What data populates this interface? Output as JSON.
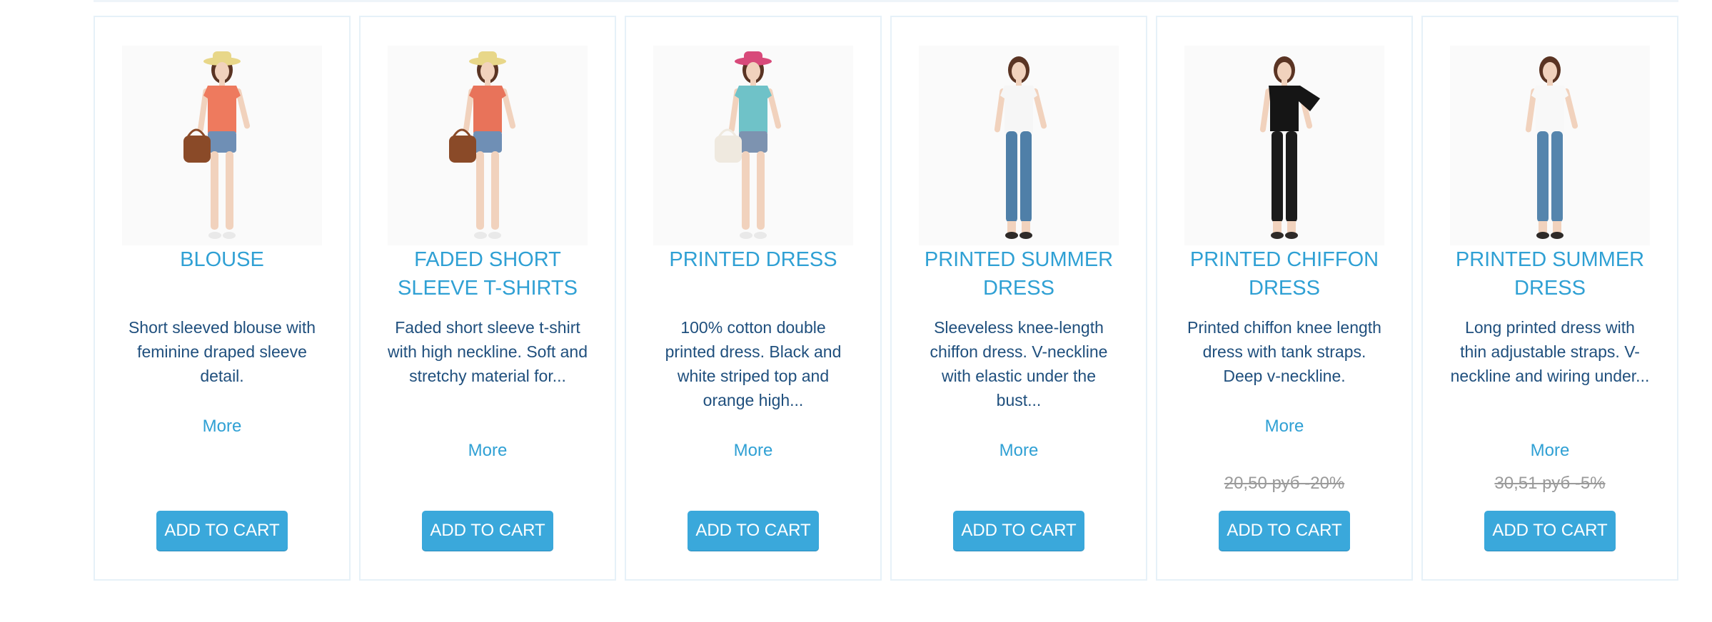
{
  "catalog": {
    "products": [
      {
        "name": "BLOUSE",
        "description": "Short sleeved blouse with feminine draped sleeve detail.",
        "more_label": "More",
        "old_price": "",
        "add_to_cart_label": "ADD TO CART",
        "image": "model-orange-blouse-bag",
        "colors": {
          "top": "#ee7a5e",
          "bottom": "#6f8fb5",
          "hat": "#e8d789",
          "bag": "#8a4a28"
        }
      },
      {
        "name": "FADED SHORT SLEEVE T-SHIRTS",
        "description": "Faded short sleeve t-shirt with high neckline. Soft and stretchy material for...",
        "more_label": "More",
        "old_price": "",
        "add_to_cart_label": "ADD TO CART",
        "image": "model-orange-tshirt-bag",
        "colors": {
          "top": "#e8735a",
          "bottom": "#6f8fb5",
          "hat": "#e8d789",
          "bag": "#8a4a28"
        }
      },
      {
        "name": "PRINTED DRESS",
        "description": "100% cotton double printed dress. Black and white striped top and orange high...",
        "more_label": "More",
        "old_price": "",
        "add_to_cart_label": "ADD TO CART",
        "image": "model-teal-top-white-bag",
        "colors": {
          "top": "#6fc2c8",
          "bottom": "#7d93b0",
          "hat": "#d84a7a",
          "bag": "#efe9df"
        }
      },
      {
        "name": "PRINTED SUMMER DRESS",
        "description": "Sleeveless knee-length chiffon dress. V-neckline with elastic under the bust...",
        "more_label": "More",
        "old_price": "",
        "add_to_cart_label": "ADD TO CART",
        "image": "model-white-top-jeans",
        "colors": {
          "top": "#f6f6f6",
          "bottom": "#4f7fa8",
          "hat": "",
          "bag": ""
        }
      },
      {
        "name": "PRINTED CHIFFON DRESS",
        "description": "Printed chiffon knee length dress with tank straps. Deep v-neckline.",
        "more_label": "More",
        "old_price": "20,50 руб -20%",
        "add_to_cart_label": "ADD TO CART",
        "image": "model-black-ruffle-outfit",
        "colors": {
          "top": "#151515",
          "bottom": "#1b1b1b",
          "hat": "",
          "bag": ""
        }
      },
      {
        "name": "PRINTED SUMMER DRESS",
        "description": "Long printed dress with thin adjustable straps. V-neckline and wiring under...",
        "more_label": "More",
        "old_price": "30,51 руб -5%",
        "add_to_cart_label": "ADD TO CART",
        "image": "model-white-top-jeans",
        "colors": {
          "top": "#f8f8f8",
          "bottom": "#5585ad",
          "hat": "",
          "bag": ""
        }
      }
    ]
  }
}
